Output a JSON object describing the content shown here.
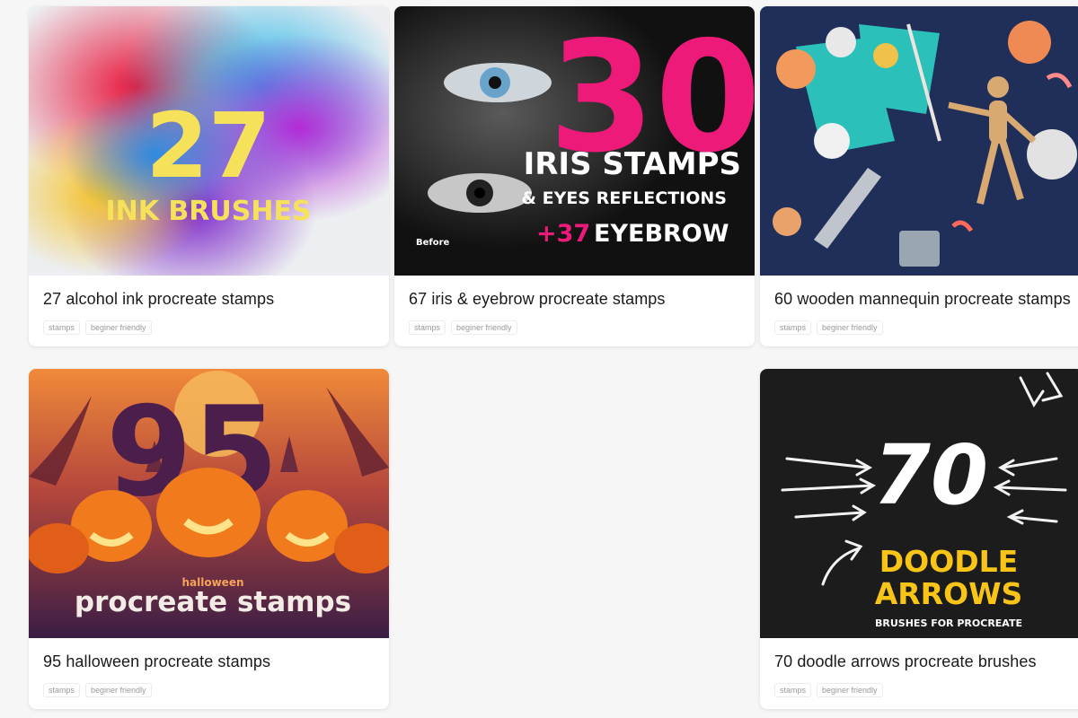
{
  "cards": [
    {
      "title": "27 alcohol ink procreate stamps",
      "tags": [
        "stamps",
        "beginer friendly"
      ],
      "image": {
        "number": "27",
        "line1": "INK BRUSHES"
      }
    },
    {
      "title": "67 iris & eyebrow procreate stamps",
      "tags": [
        "stamps",
        "beginer friendly"
      ],
      "image": {
        "number": "30",
        "line1": "IRIS STAMPS",
        "line2": "& EYES REFLECTIONS",
        "line3_a": "+37",
        "line3_b": "EYEBROW",
        "caption": "Before"
      }
    },
    {
      "title": "60 wooden mannequin procreate stamps",
      "tags": [
        "stamps",
        "beginer friendly"
      ],
      "image": {}
    },
    {
      "title": "95 halloween procreate stamps",
      "tags": [
        "stamps",
        "beginer friendly"
      ],
      "image": {
        "number": "95",
        "line1": "halloween",
        "line2": "procreate stamps"
      }
    },
    {
      "title": "70 doodle arrows procreate brushes",
      "tags": [
        "stamps",
        "beginer friendly"
      ],
      "image": {
        "number": "70",
        "line1": "DOODLE",
        "line2": "ARROWS",
        "line3": "BRUSHES FOR PROCREATE"
      }
    }
  ],
  "colors": {
    "page_bg": "#f6f6f7",
    "card_bg": "#ffffff",
    "iris_pink": "#ee1a7a",
    "pumpkin_orange": "#f07a1c",
    "doodle_yellow": "#f8c418",
    "mannequin_bg": "#1f2f5a"
  }
}
